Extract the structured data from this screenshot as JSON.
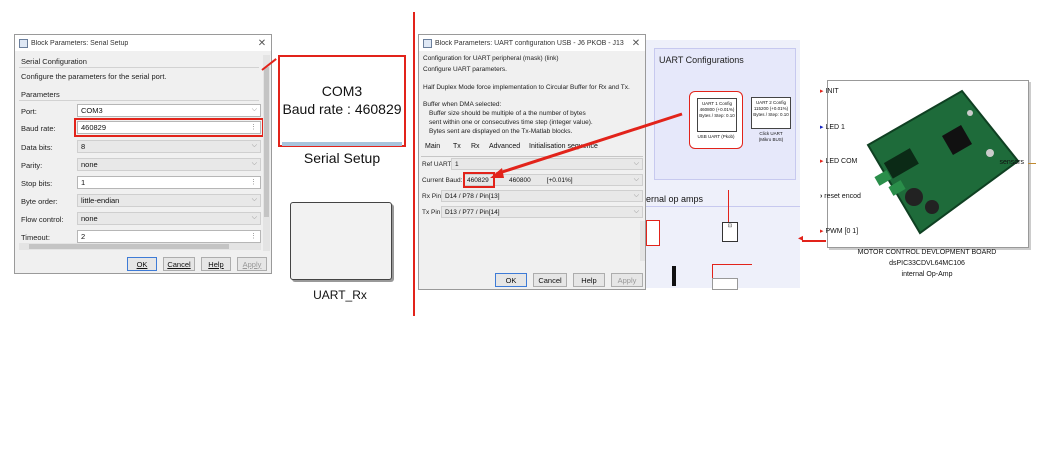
{
  "serial_dialog": {
    "title": "Block Parameters: Serial Setup",
    "section": "Serial Configuration",
    "description": "Configure the parameters for the serial port.",
    "params_header": "Parameters",
    "fields": [
      {
        "label": "Port:",
        "value": "COM3"
      },
      {
        "label": "Baud rate:",
        "value": "460829"
      },
      {
        "label": "Data bits:",
        "value": "8"
      },
      {
        "label": "Parity:",
        "value": "none"
      },
      {
        "label": "Stop bits:",
        "value": "1"
      },
      {
        "label": "Byte order:",
        "value": "little-endian"
      },
      {
        "label": "Flow control:",
        "value": "none"
      },
      {
        "label": "Timeout:",
        "value": "2"
      }
    ],
    "buttons": {
      "ok": "OK",
      "cancel": "Cancel",
      "help": "Help",
      "apply": "Apply"
    }
  },
  "serial_block": {
    "line1": "COM3",
    "line2": "Baud rate : 460829",
    "name": "Serial Setup"
  },
  "uart_rx_block": {
    "name": "UART_Rx"
  },
  "uart_dialog": {
    "title": "Block Parameters: UART configuration USB - J6 PKOB - J13",
    "line1": "Configuration for UART peripheral (mask) (link)",
    "line2": "Configure UART parameters.",
    "line3": "Half Duplex Mode force implementation to Circular Buffer for Rx and Tx.",
    "dma_lines": [
      "Buffer when DMA selected:",
      "Buffer size should be multiple of a the number of bytes",
      "sent within one or consecutives time step (integer value).",
      "Bytes sent are displayed on the Tx-Matlab blocks."
    ],
    "tabs": [
      "Main",
      "Tx",
      "Rx",
      "Advanced",
      "Initialisation sequence"
    ],
    "ref_uart": {
      "label": "Ref UART",
      "value": "1"
    },
    "current_baud": {
      "label": "Current Baud:",
      "value": "460829",
      "target": "460800",
      "error": "[+0.01%]"
    },
    "rx_pin": {
      "label": "Rx Pin",
      "value": "D14 / P78 / Pin[13]"
    },
    "tx_pin": {
      "label": "Tx Pin",
      "value": "D13 / P77 / Pin[14]"
    },
    "buttons": {
      "ok": "OK",
      "cancel": "Cancel",
      "help": "Help",
      "apply": "Apply"
    }
  },
  "model_canvas": {
    "uart_configs_title": "UART Configurations",
    "uart1": {
      "line1": "UART 1 Config",
      "line2": "460800 (+0.01%)",
      "line3": "Bytes / Step: 0.10",
      "caption": "USB UART (Pkob)"
    },
    "uart2": {
      "line1": "UART 2 Config",
      "line2": "115200 (+0.01%)",
      "line3": "Bytes / Step: 0.10",
      "caption1": "Click UART",
      "caption2": "(Mikro BUS)"
    },
    "op_amps_title": "ernal op amps"
  },
  "board_block": {
    "ports_in": [
      "INIT",
      "LED 1",
      "LED COM",
      "reset encod",
      "PWM [0 1]"
    ],
    "port_out": "sensors",
    "caption1": "MOTOR CONTROL DEVLOPMENT BOARD",
    "caption2": "dsPIC33CDVL64MC106",
    "caption3": "internal Op-Amp"
  },
  "colors": {
    "accent_red": "#e2231a",
    "window_bg": "#f0f0f0",
    "canvas_bg": "#eef0fa"
  }
}
